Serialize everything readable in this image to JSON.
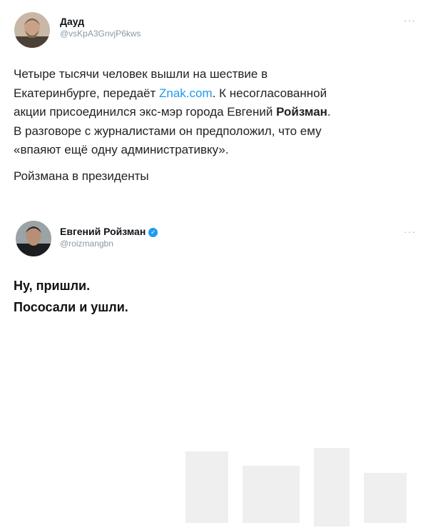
{
  "tweet1": {
    "author_name": "Дауд",
    "author_handle": "@vsKpA3GnvjP6kws",
    "more_icon": "ellipsis-icon",
    "lines": {
      "l1": "Четыре тысячи человек вышли на шествие в",
      "l2a": "Екатеринбурге, передаёт ",
      "l2link": "Znak.com",
      "l2b": ". К несогласованной",
      "l3": "акции присоединился экс-мэр города Евгений ",
      "l3bold": "Ройзман",
      "l3end": ".",
      "l4": "В разговоре с журналистами он предположил, что ему",
      "l5": "«впаяют ещё одну административку».",
      "l6": "Ройзмана в президенты"
    }
  },
  "tweet2": {
    "author_name": "Евгений Ройзман",
    "author_handle": "@roizmangbn",
    "verified_icon": "verified-badge-icon",
    "more_icon": "ellipsis-icon",
    "lines": {
      "l1": "Ну, пришли.",
      "l2": "Пососали и ушли."
    }
  },
  "colors": {
    "link": "#1d9bf0",
    "handle": "#8b98a5",
    "verified": "#1d9bf0"
  }
}
